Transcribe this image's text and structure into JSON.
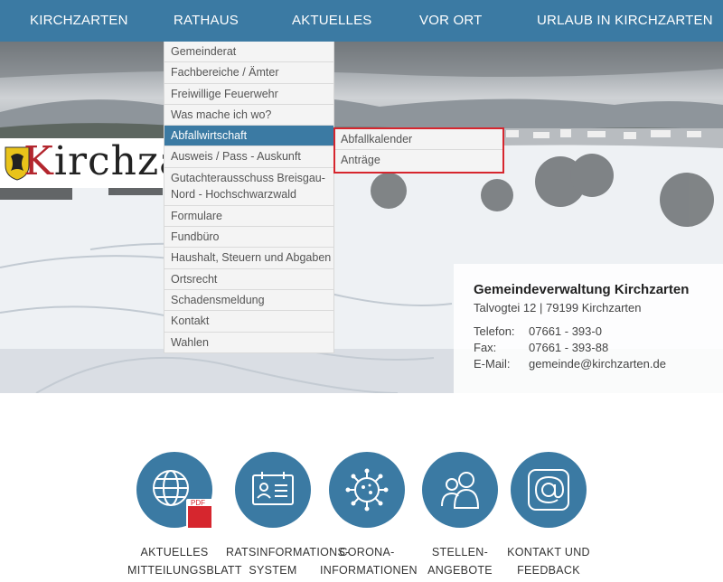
{
  "nav": {
    "items": [
      "KIRCHZARTEN",
      "RATHAUS",
      "AKTUELLES",
      "VOR ORT",
      "URLAUB IN KIRCHZARTEN"
    ]
  },
  "logo": {
    "text_first": "K",
    "text_rest": "irchza"
  },
  "dropdown": {
    "items": [
      "Gemeinderat",
      "Fachbereiche / Ämter",
      "Freiwillige Feuerwehr",
      "Was mache ich wo?",
      "Abfallwirtschaft",
      "Ausweis / Pass - Auskunft",
      "Gutachterausschuss Breisgau-Nord - Hochschwarzwald",
      "Formulare",
      "Fundbüro",
      "Haushalt, Steuern und Abgaben",
      "Ortsrecht",
      "Schadensmeldung",
      "Kontakt",
      "Wahlen"
    ],
    "active": "Abfallwirtschaft"
  },
  "submenu": {
    "items": [
      "Abfallkalender",
      "Anträge"
    ]
  },
  "contact": {
    "title": "Gemeindeverwaltung Kirchzarten",
    "address": "Talvogtei 12 | 79199 Kirchzarten",
    "phone_label": "Telefon:",
    "phone": "07661 - 393-0",
    "fax_label": "Fax:",
    "fax": "07661 - 393-88",
    "email_label": "E-Mail:",
    "email": "gemeinde@kirchzarten.de"
  },
  "tiles": [
    {
      "label": "AKTUELLES\nMITTEILUNGSBLATT",
      "icon": "globe-pdf-icon"
    },
    {
      "label": "RATSINFORMATIONS-\nSYSTEM",
      "icon": "id-card-icon"
    },
    {
      "label": "CORONA-\nINFORMATIONEN",
      "icon": "virus-icon"
    },
    {
      "label": "STELLEN-\nANGEBOTE",
      "icon": "people-icon"
    },
    {
      "label": "KONTAKT UND\nFEEDBACK",
      "icon": "at-sign-icon"
    }
  ],
  "pdf_badge": "PDF",
  "colors": {
    "primary": "#3b7aa3",
    "highlight": "#d6262e",
    "logo_red": "#b3262e"
  }
}
